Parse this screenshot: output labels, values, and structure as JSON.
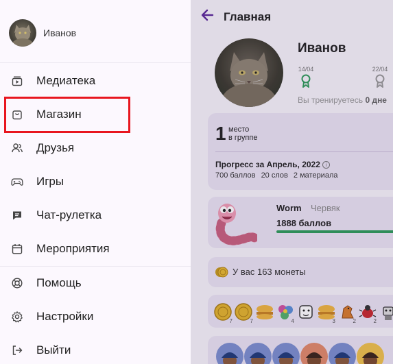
{
  "header": {
    "title": "Главная",
    "back_icon": "arrow-left-icon"
  },
  "profile": {
    "name": "Иванов",
    "achievements": [
      {
        "date": "14/04",
        "icon": "award-icon",
        "color": "#2e9b5a"
      },
      {
        "date": "22/04",
        "icon": "award-icon",
        "color": "#999999"
      }
    ],
    "streak_text": "Вы тренируетесь ",
    "streak_value": "0 дне"
  },
  "rank": {
    "place": "1",
    "place_label_1": "место",
    "place_label_2": "в группе",
    "progress_title": "Прогресс за Апрель, 2022",
    "stats": [
      "700 баллов",
      "20 слов",
      "2 материала"
    ]
  },
  "level": {
    "name": "Worm",
    "type": "Червяк",
    "points": "1888 баллов",
    "progress_fraction": 1.0,
    "progress_color": "#2e9b5a"
  },
  "coins": {
    "text": "У вас 163 монеты"
  },
  "items": [
    {
      "icon": "coin-icon",
      "count": "7"
    },
    {
      "icon": "coin-icon",
      "count": "7"
    },
    {
      "icon": "burger-icon",
      "count": ""
    },
    {
      "icon": "flower-icon",
      "count": "4"
    },
    {
      "icon": "dog-icon",
      "count": ""
    },
    {
      "icon": "burger-icon",
      "count": "3"
    },
    {
      "icon": "horse-icon",
      "count": "2"
    },
    {
      "icon": "bug-icon",
      "count": "2"
    },
    {
      "icon": "robot-icon",
      "count": ""
    }
  ],
  "drawer": {
    "user_name": "Иванов",
    "menu": [
      {
        "label": "Медиатека",
        "icon": "media-library-icon"
      },
      {
        "label": "Магазин",
        "icon": "shopping-bag-icon"
      },
      {
        "label": "Друзья",
        "icon": "friends-icon"
      },
      {
        "label": "Игры",
        "icon": "gamepad-icon"
      },
      {
        "label": "Чат-рулетка",
        "icon": "chat-icon"
      },
      {
        "label": "Мероприятия",
        "icon": "calendar-icon"
      }
    ],
    "bottom_menu": [
      {
        "label": "Помощь",
        "icon": "help-lifebuoy-icon"
      },
      {
        "label": "Настройки",
        "icon": "settings-gear-icon"
      },
      {
        "label": "Выйти",
        "icon": "logout-icon"
      }
    ]
  },
  "colors": {
    "accent": "#5d2a9b",
    "highlight": "#e8161f",
    "drawer_bg": "#fcf8fe",
    "main_bg": "#f7f4fb"
  }
}
